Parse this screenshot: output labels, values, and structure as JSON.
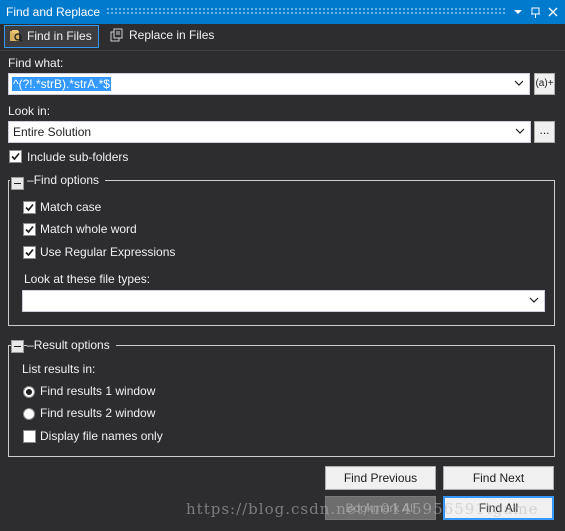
{
  "window": {
    "title": "Find and Replace",
    "dropdown_icon": "chevron-down-icon",
    "pin_icon": "pin-icon",
    "close_icon": "close-icon"
  },
  "tabs": [
    {
      "label": "Find in Files",
      "icon": "find-in-files-icon",
      "active": true
    },
    {
      "label": "Replace in Files",
      "icon": "replace-in-files-icon",
      "active": false
    }
  ],
  "find_what": {
    "label": "Find what:",
    "value": "^(?!.*strB).*strA.*$",
    "regex_builder_label": "(a)+"
  },
  "look_in": {
    "label": "Look in:",
    "value": "Entire Solution",
    "browse_label": "..."
  },
  "include_subfolders": {
    "label": "Include sub-folders",
    "checked": true
  },
  "find_options": {
    "title": "Find options",
    "match_case": {
      "label": "Match case",
      "checked": true
    },
    "match_whole_word": {
      "label": "Match whole word",
      "checked": true
    },
    "use_regex": {
      "label": "Use Regular Expressions",
      "checked": true
    },
    "file_types_label": "Look at these file types:",
    "file_types_value": ""
  },
  "result_options": {
    "title": "Result options",
    "list_results_label": "List results in:",
    "find_results_1": {
      "label": "Find results 1 window",
      "selected": true
    },
    "find_results_2": {
      "label": "Find results 2 window",
      "selected": false
    },
    "display_file_names": {
      "label": "Display file names only",
      "checked": false
    }
  },
  "buttons": {
    "find_previous": "Find Previous",
    "find_next": "Find Next",
    "bookmark_all": "Bookmark All",
    "find_all": "Find All"
  },
  "colors": {
    "title_bar": "#007acc",
    "background": "#2d2d30",
    "selection": "#3399ff"
  },
  "watermark": "https://blog.csdn.net/u0145956591tgame"
}
